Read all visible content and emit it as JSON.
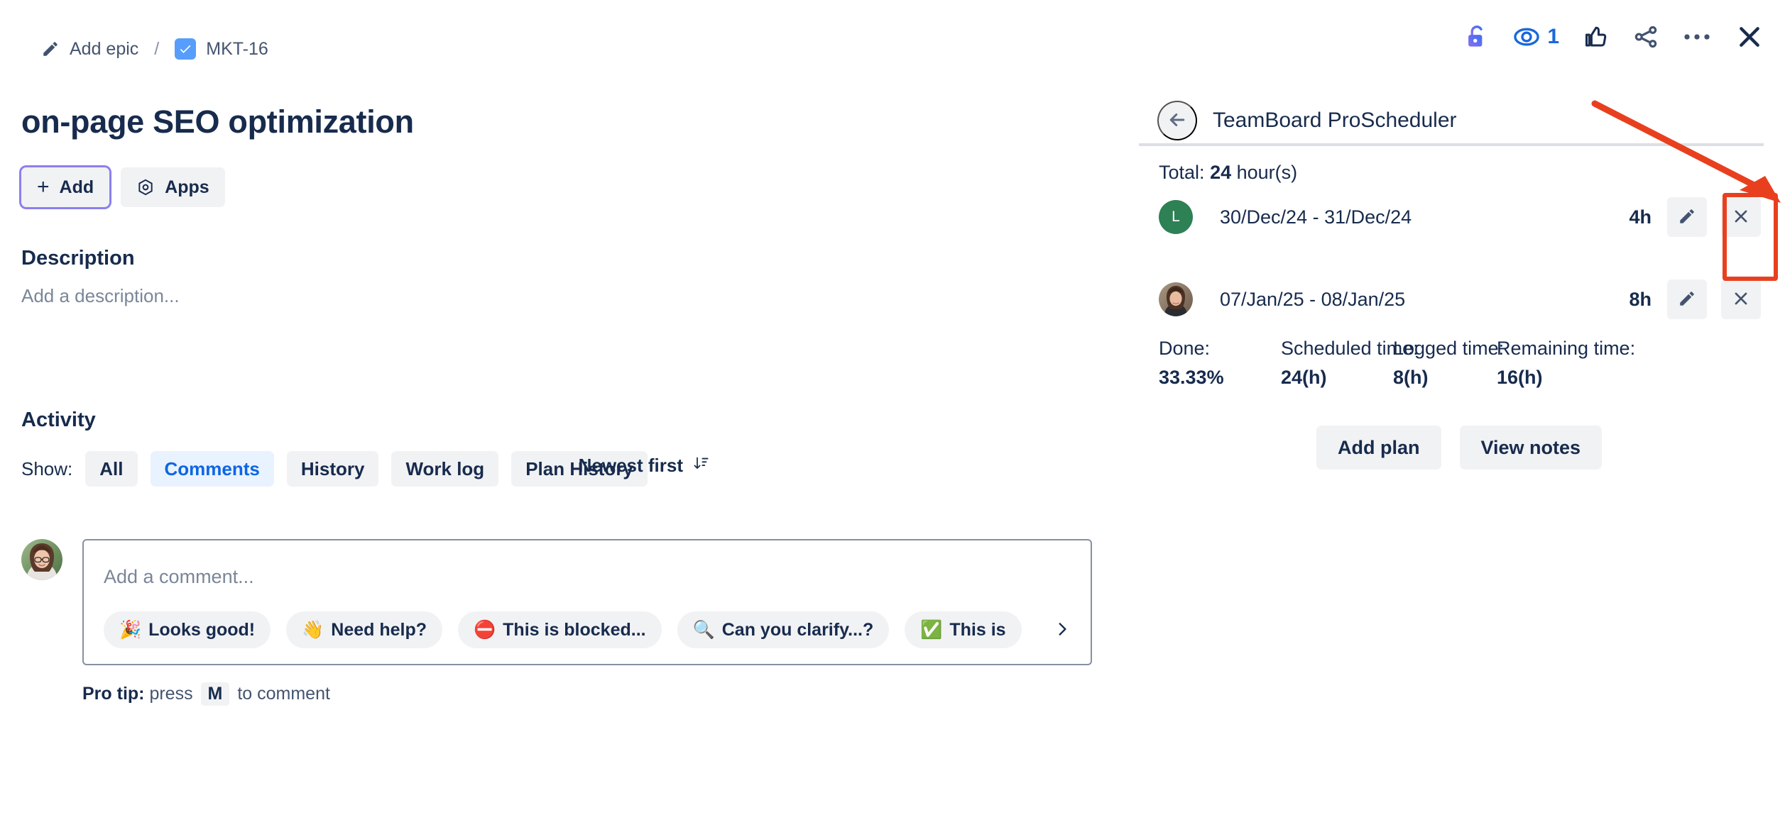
{
  "breadcrumb": {
    "epic_label": "Add epic",
    "separator": "/",
    "issue_key": "MKT-16",
    "epic_icon": "pencil-icon",
    "issue_icon": "task-check-icon"
  },
  "issue": {
    "title": "on-page SEO optimization"
  },
  "actions": {
    "add_label": "Add",
    "apps_label": "Apps",
    "add_icon": "plus-icon",
    "apps_icon": "apps-hexagon-icon"
  },
  "description": {
    "heading": "Description",
    "placeholder": "Add a description..."
  },
  "activity": {
    "heading": "Activity",
    "show_label": "Show:",
    "tabs": [
      {
        "label": "All",
        "active": false
      },
      {
        "label": "Comments",
        "active": true
      },
      {
        "label": "History",
        "active": false
      },
      {
        "label": "Work log",
        "active": false
      },
      {
        "label": "Plan History",
        "active": false
      }
    ],
    "sort_label": "Newest first",
    "sort_icon": "sort-descending-icon"
  },
  "composer": {
    "placeholder": "Add a comment...",
    "avatar": "user-avatar-photo",
    "next_icon": "chevron-right-icon",
    "chips": [
      {
        "emoji": "🎉",
        "label": "Looks good!"
      },
      {
        "emoji": "👋",
        "label": "Need help?"
      },
      {
        "emoji": "⛔",
        "label": "This is blocked..."
      },
      {
        "emoji": "🔍",
        "label": "Can you clarify...?"
      },
      {
        "emoji": "✅",
        "label": "This is"
      }
    ],
    "protip_prefix": "Pro tip:",
    "protip_mid": "press",
    "protip_key": "M",
    "protip_suffix": "to comment"
  },
  "toolbar": {
    "items": [
      {
        "name": "lock-icon",
        "label": ""
      },
      {
        "name": "watch-eye-icon",
        "label": "1"
      },
      {
        "name": "thumbs-up-icon",
        "label": ""
      },
      {
        "name": "share-icon",
        "label": ""
      },
      {
        "name": "more-actions-icon",
        "label": ""
      },
      {
        "name": "close-icon",
        "label": ""
      }
    ],
    "watch_count": "1"
  },
  "panel": {
    "title": "TeamBoard ProScheduler",
    "back_icon": "arrow-left-icon",
    "total_prefix": "Total:",
    "total_value": "24",
    "total_suffix": "hour(s)",
    "plans": [
      {
        "avatar_type": "letter",
        "avatar_letter": "L",
        "avatar_color": "#2e8055",
        "dates": "30/Dec/24 - 31/Dec/24",
        "hours": "4h",
        "edit_icon": "pencil-icon",
        "delete_icon": "close-x-icon"
      },
      {
        "avatar_type": "photo",
        "avatar_letter": "",
        "avatar_color": "",
        "dates": "07/Jan/25 - 08/Jan/25",
        "hours": "8h",
        "edit_icon": "pencil-icon",
        "delete_icon": "close-x-icon"
      }
    ],
    "stats": [
      {
        "key": "Done:",
        "value": "33.33%"
      },
      {
        "key": "Scheduled time:",
        "value": "24(h)"
      },
      {
        "key": "Logged time:",
        "value": "8(h)"
      },
      {
        "key": "Remaining time:",
        "value": "16(h)"
      }
    ],
    "add_plan_label": "Add plan",
    "view_notes_label": "View notes"
  },
  "annotation": {
    "color": "#e8401f",
    "arrow": "red-arrow-pointing-to-delete-buttons",
    "box": "red-highlight-box-around-delete-buttons"
  },
  "colors": {
    "accent_blue": "#0c66e4",
    "text": "#172b4d",
    "muted": "#7a8699",
    "chip_bg": "#f1f2f4",
    "green_avatar": "#2e8055",
    "annotation_red": "#e8401f",
    "focus_purple": "#8b7ff0"
  }
}
